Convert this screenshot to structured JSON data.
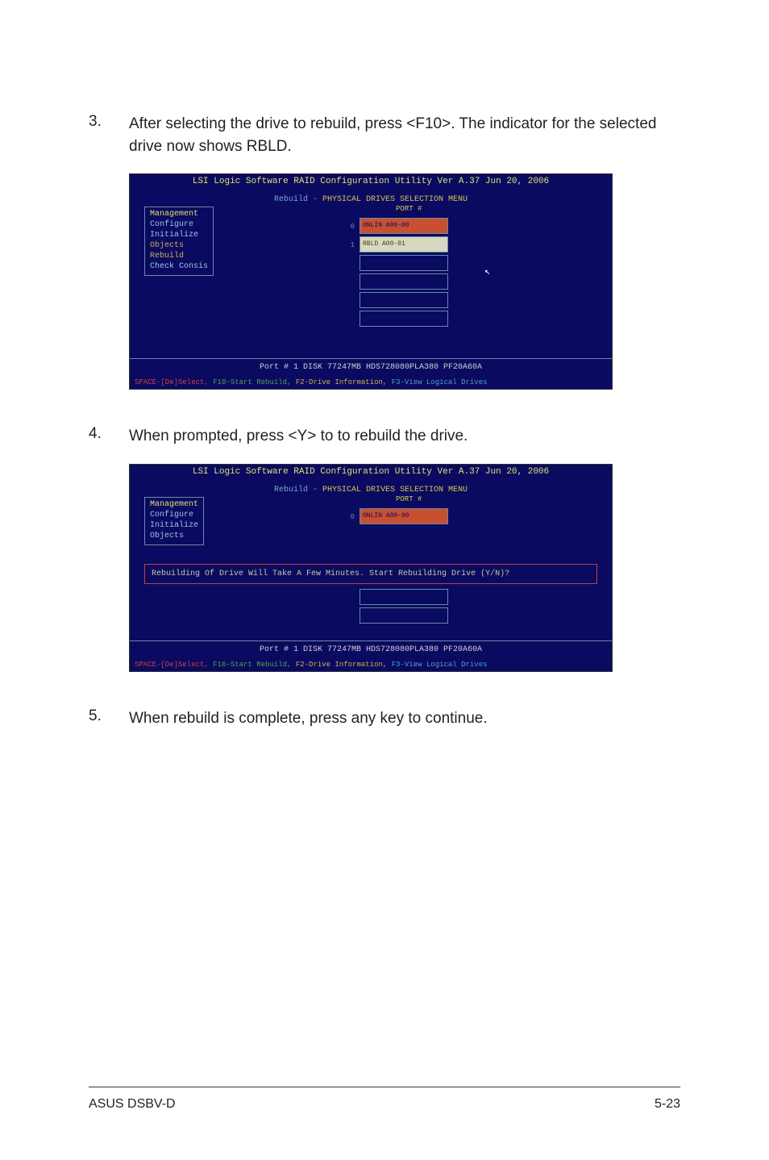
{
  "steps": {
    "s3": {
      "num": "3.",
      "text": "After selecting the drive to rebuild, press <F10>. The indicator for the selected drive now shows RBLD."
    },
    "s4": {
      "num": "4.",
      "text": "When prompted, press <Y> to to rebuild the drive."
    },
    "s5": {
      "num": "5.",
      "text": "When rebuild is complete, press any key to continue."
    }
  },
  "bios1": {
    "title": "LSI Logic Software RAID Configuration Utility Ver A.37 Jun 20, 2006",
    "rebuild_prefix": "Rebuild - ",
    "rebuild_header": "PHYSICAL DRIVES SELECTION MENU",
    "port_label": "PORT #",
    "menu": {
      "management": "Management",
      "configure": "Configure",
      "initialize": "Initialize",
      "objects": "Objects",
      "rebuild": "Rebuild",
      "check": "Check Consis"
    },
    "drives": {
      "d0_num": "0",
      "d0_text": "ONLIN A00-00",
      "d1_num": "1",
      "d1_text": "RBLD A00-01"
    },
    "status": "Port #  1 DISK  77247MB    HDS728080PLA380    PF20A60A",
    "footer": {
      "p1": "SPACE-[De]Select,",
      "p2": "F10-Start Rebuild,",
      "p3": "F2-Drive Information,",
      "p4": "F3-View Logical Drives"
    }
  },
  "bios2": {
    "title": "LSI Logic Software RAID Configuration Utility Ver A.37 Jun 20, 2006",
    "rebuild_prefix": "Rebuild - ",
    "rebuild_header": "PHYSICAL DRIVES SELECTION MENU",
    "port_label": "PORT #",
    "menu": {
      "management": "Management",
      "configure": "Configure",
      "initialize": "Initialize",
      "objects": "Objects"
    },
    "drives": {
      "d0_num": "0",
      "d0_text": "ONLIN A00-00"
    },
    "rebuild_msg": "Rebuilding Of Drive Will Take A Few Minutes. Start Rebuilding Drive (Y/N)?",
    "status": "Port #  1 DISK  77247MB    HDS728080PLA380    PF20A60A",
    "footer": {
      "p1": "SPACE-[De]Select,",
      "p2": "F10-Start Rebuild,",
      "p3": "F2-Drive Information,",
      "p4": "F3-View Logical Drives"
    }
  },
  "footer": {
    "left": "ASUS DSBV-D",
    "right": "5-23"
  }
}
